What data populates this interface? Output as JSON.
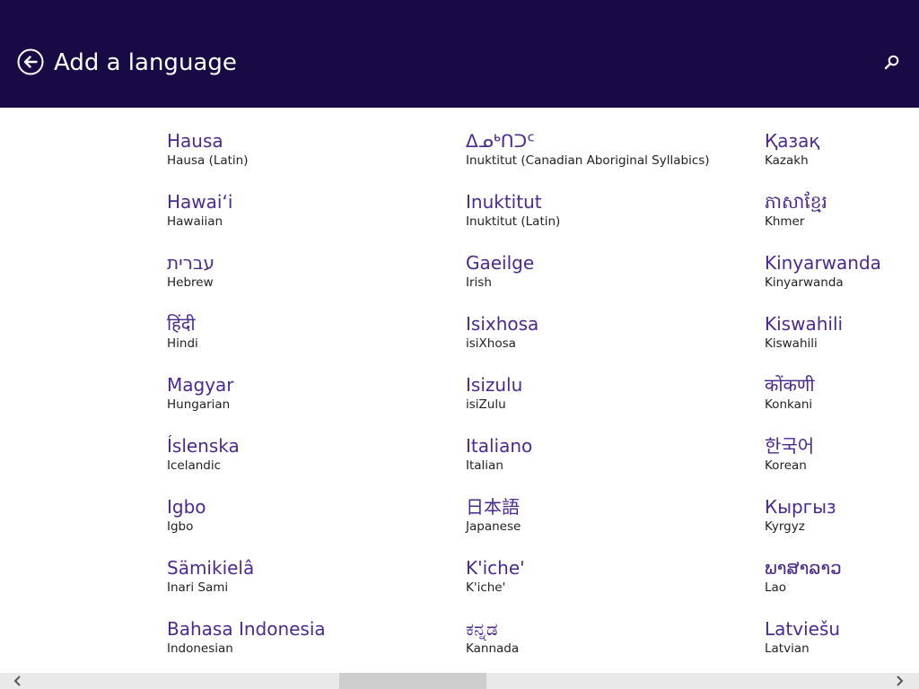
{
  "header": {
    "title": "Add a language",
    "back_icon": "back-arrow-circle-icon",
    "search_icon": "search-icon",
    "background_color": "#180a45"
  },
  "accent_color": "#4b2a8f",
  "languages": {
    "col0": [
      {
        "native": "Hausa",
        "english": "Hausa (Latin)"
      },
      {
        "native": "Hawaiʻi",
        "english": "Hawaiian"
      },
      {
        "native": "עברית",
        "english": "Hebrew"
      },
      {
        "native": "हिंदी",
        "english": "Hindi"
      },
      {
        "native": "Magyar",
        "english": "Hungarian"
      },
      {
        "native": "Íslenska",
        "english": "Icelandic"
      },
      {
        "native": "Igbo",
        "english": "Igbo"
      },
      {
        "native": "Sämikielâ",
        "english": "Inari Sami"
      },
      {
        "native": "Bahasa Indonesia",
        "english": "Indonesian"
      }
    ],
    "col1": [
      {
        "native": "ᐃᓄᒃᑎᑐᑦ",
        "english": "Inuktitut (Canadian Aboriginal Syllabics)"
      },
      {
        "native": "Inuktitut",
        "english": "Inuktitut (Latin)"
      },
      {
        "native": "Gaeilge",
        "english": "Irish"
      },
      {
        "native": "Isixhosa",
        "english": "isiXhosa"
      },
      {
        "native": "Isizulu",
        "english": "isiZulu"
      },
      {
        "native": "Italiano",
        "english": "Italian"
      },
      {
        "native": "日本語",
        "english": "Japanese"
      },
      {
        "native": "K'iche'",
        "english": "K'iche'"
      },
      {
        "native": "ಕನ್ನಡ",
        "english": "Kannada"
      }
    ],
    "col2": [
      {
        "native": "Қазақ",
        "english": "Kazakh"
      },
      {
        "native": "ភាសាខ្មែរ",
        "english": "Khmer"
      },
      {
        "native": "Kinyarwanda",
        "english": "Kinyarwanda"
      },
      {
        "native": "Kiswahili",
        "english": "Kiswahili"
      },
      {
        "native": "कोंकणी",
        "english": "Konkani"
      },
      {
        "native": "한국어",
        "english": "Korean"
      },
      {
        "native": "Кыргыз",
        "english": "Kyrgyz"
      },
      {
        "native": "ພາສາລາວ",
        "english": "Lao"
      },
      {
        "native": "Latviešu",
        "english": "Latvian"
      }
    ]
  },
  "scrollbar": {
    "left_icon": "chevron-left-icon",
    "right_icon": "chevron-right-icon"
  }
}
